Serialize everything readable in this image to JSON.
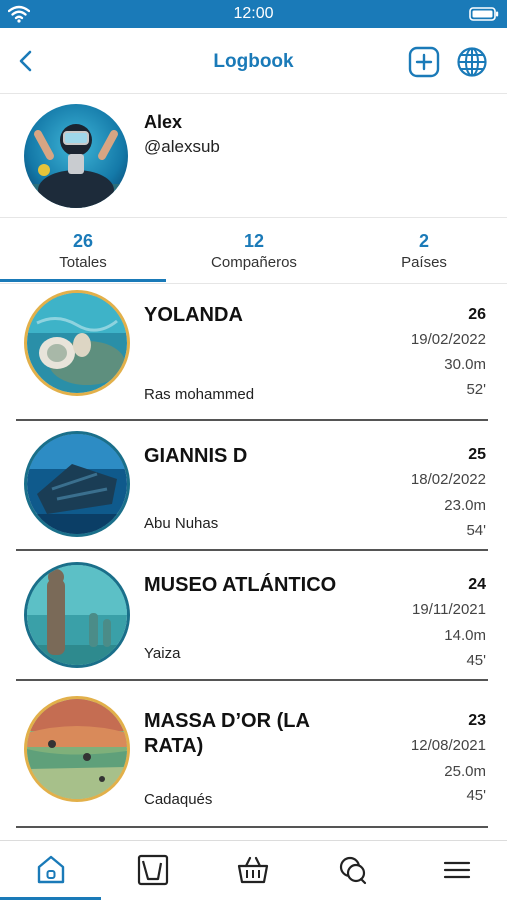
{
  "status_bar": {
    "time": "12:00"
  },
  "header": {
    "title": "Logbook"
  },
  "profile": {
    "name": "Alex",
    "handle": "@alexsub"
  },
  "tabs": [
    {
      "count": "26",
      "label": "Totales"
    },
    {
      "count": "12",
      "label": "Compañeros"
    },
    {
      "count": "2",
      "label": "Países"
    }
  ],
  "dives": [
    {
      "name": "YOLANDA",
      "place": "Ras mohammed",
      "number": "26",
      "date": "19/02/2022",
      "depth": "30.0m",
      "time": "52'"
    },
    {
      "name": "GIANNIS D",
      "place": "Abu Nuhas",
      "number": "25",
      "date": "18/02/2022",
      "depth": "23.0m",
      "time": "54'"
    },
    {
      "name": "MUSEO ATLÁNTICO",
      "place": "Yaiza",
      "number": "24",
      "date": "19/11/2021",
      "depth": "14.0m",
      "time": "45'"
    },
    {
      "name": "MASSA D’OR (LA RATA)",
      "place": "Cadaqués",
      "number": "23",
      "date": "12/08/2021",
      "depth": "25.0m",
      "time": "45'"
    }
  ],
  "bottom_nav": [
    {
      "icon": "home-icon"
    },
    {
      "icon": "dive-profile-chart-icon"
    },
    {
      "icon": "shopping-basket-icon"
    },
    {
      "icon": "chat-bubbles-icon"
    },
    {
      "icon": "menu-icon"
    }
  ],
  "colors": {
    "accent": "#1a7ab8",
    "ring_gold": "#e2b04a",
    "ring_teal": "#1a6f8a"
  }
}
